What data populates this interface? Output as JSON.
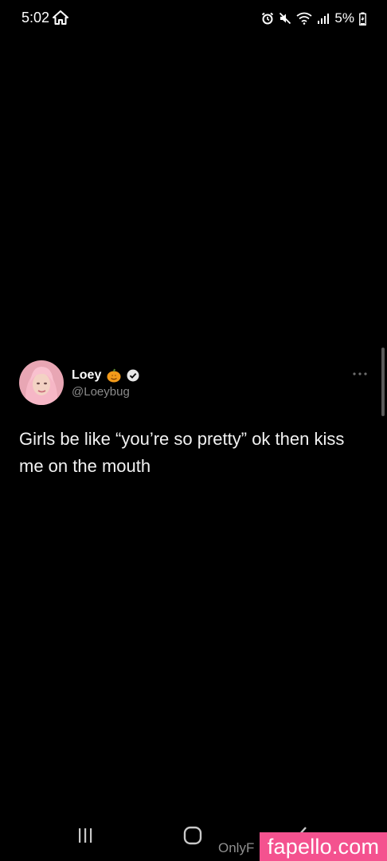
{
  "status_bar": {
    "time": "5:02",
    "battery_percent": "5%",
    "icons": [
      "home-icon",
      "alarm-icon",
      "mute-icon",
      "wifi-icon",
      "signal-icon",
      "battery-icon"
    ]
  },
  "tweet": {
    "display_name": "Loey",
    "emoji_icon": "pumpkin-icon",
    "verified_icon": "verified-badge-icon",
    "handle": "@Loeybug",
    "text": "Girls be like “you’re so pretty” ok then kiss me on the mouth",
    "more_icon": "more-options-icon"
  },
  "nav_bar": {
    "icons": [
      "recent-apps-icon",
      "home-button-icon",
      "back-icon"
    ]
  },
  "watermarks": {
    "onlyfans_text": "OnlyF",
    "brand": "fapello.com",
    "brand_color": "#f4528f"
  }
}
